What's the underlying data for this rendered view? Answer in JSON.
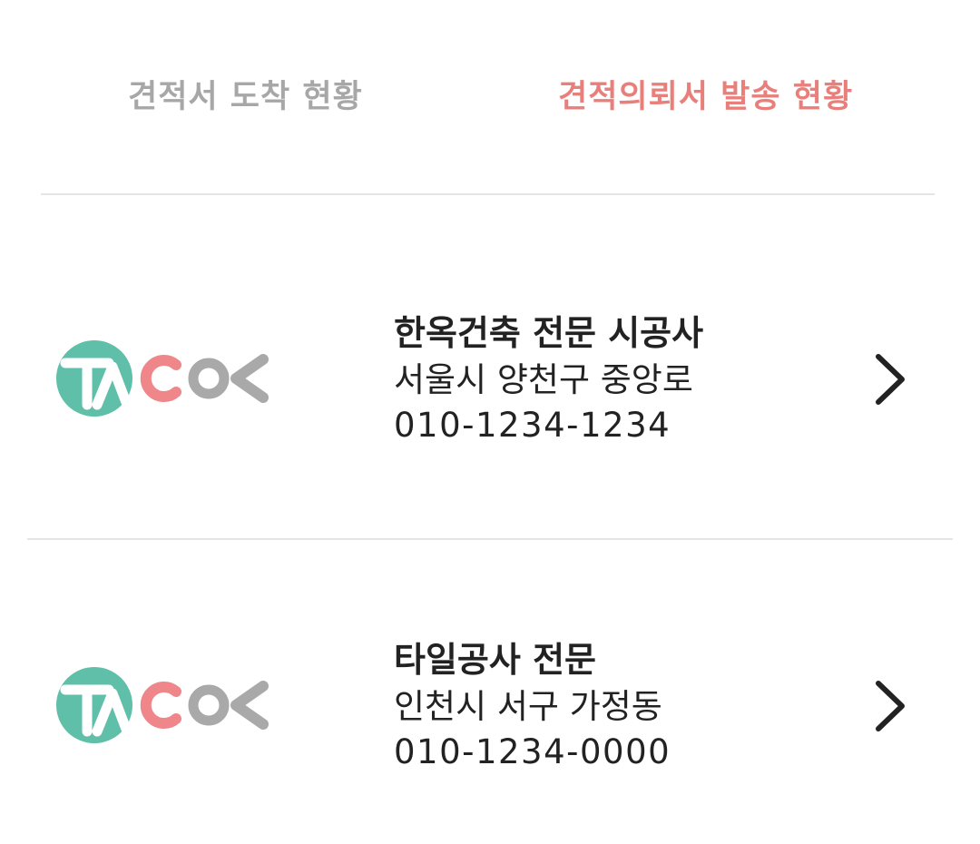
{
  "tabs": [
    {
      "label": "견적서 도착 현황",
      "active": false
    },
    {
      "label": "견적의뢰서 발송 현황",
      "active": true
    }
  ],
  "colors": {
    "active_tab": "#e87f7b",
    "inactive_tab": "#a7a7a7",
    "logo_teal": "#5fbfa8",
    "logo_pink": "#ee868a",
    "logo_gray": "#a9a9a9"
  },
  "items": [
    {
      "name": "한옥건축 전문 시공사",
      "address": "서울시 양천구 중앙로",
      "phone": "010-1234-1234",
      "logo": "taco-logo",
      "icon": "chevron-right-icon"
    },
    {
      "name": "타일공사 전문",
      "address": "인천시 서구 가정동",
      "phone": "010-1234-0000",
      "logo": "taco-logo",
      "icon": "chevron-right-icon"
    }
  ]
}
